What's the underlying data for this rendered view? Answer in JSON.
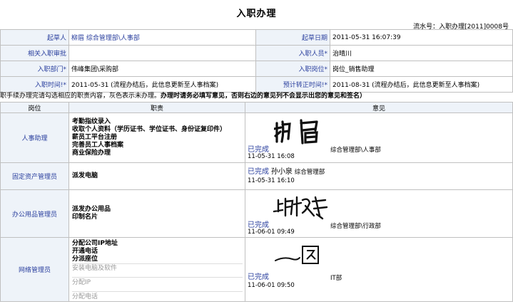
{
  "page": {
    "title": "入职办理",
    "flow_no": "流水号：入职办理[2011]0008号"
  },
  "header": {
    "drafter_label": "起草人",
    "drafter_value": "柳眉 综合管理部\\人事部",
    "draft_date_label": "起草日期",
    "draft_date_value": "2011-05-31 16:07:39",
    "related_label": "相关入职审批",
    "related_value": "",
    "entrant_label": "入职人员*",
    "entrant_value": "治晴川",
    "dept_label": "入职部门*",
    "dept_value": "伟峰集团\\采购部",
    "post_label": "入职岗位*",
    "post_value": "岗位_销售助理",
    "time_label": "入职时间!*",
    "time_value": "2011-05-31 (流程办结后，此信息更新至人事档案)",
    "regular_label": "预计转正时间!*",
    "regular_value": "2011-08-31 (流程办结后，此信息更新至人事档案)"
  },
  "notice": {
    "text": "职手续办理完请勾选相应的职责内容，灰色表示未办理。",
    "bold": "办理时请务必填写意见，否则右边的意见列不会显示出您的意见和签名）"
  },
  "tasks": {
    "col_position": "岗位",
    "col_duty": "职责",
    "col_opinion": "意见",
    "rows": [
      {
        "position": "人事助理",
        "duties": [
          "考勤指纹录入",
          "收取个人资料（学历证书、学位证书、身份证复印件）",
          "薪员工平台注册",
          "完善员工人事档案",
          "商业保险办理"
        ],
        "status": "已完成",
        "datetime": "11-05-31 16:08",
        "dept": "综合管理部\\人事部",
        "signer": "柳眉"
      },
      {
        "position": "固定资产管理员",
        "duties": [
          "派发电脑"
        ],
        "status": "已完成",
        "signer": "孙小泉",
        "dept": "综合管理部",
        "datetime": "11-05-31 16:10"
      },
      {
        "position": "办公用品管理员",
        "duties": [
          "派发办公用品",
          "印制名片"
        ],
        "status": "已完成",
        "datetime": "11-06-01 09:49",
        "dept": "综合管理部\\行政部",
        "signer": "上官博美"
      },
      {
        "position": "网络管理员",
        "duties": [
          "分配公司IP地址",
          "开通电话",
          "分派座位"
        ],
        "pending": [
          "安装电脑及软件",
          "分配IP",
          "分配电话"
        ],
        "status": "已完成",
        "datetime": "11-06-01 09:50",
        "dept": "IT部",
        "signer": "一阳"
      }
    ]
  }
}
